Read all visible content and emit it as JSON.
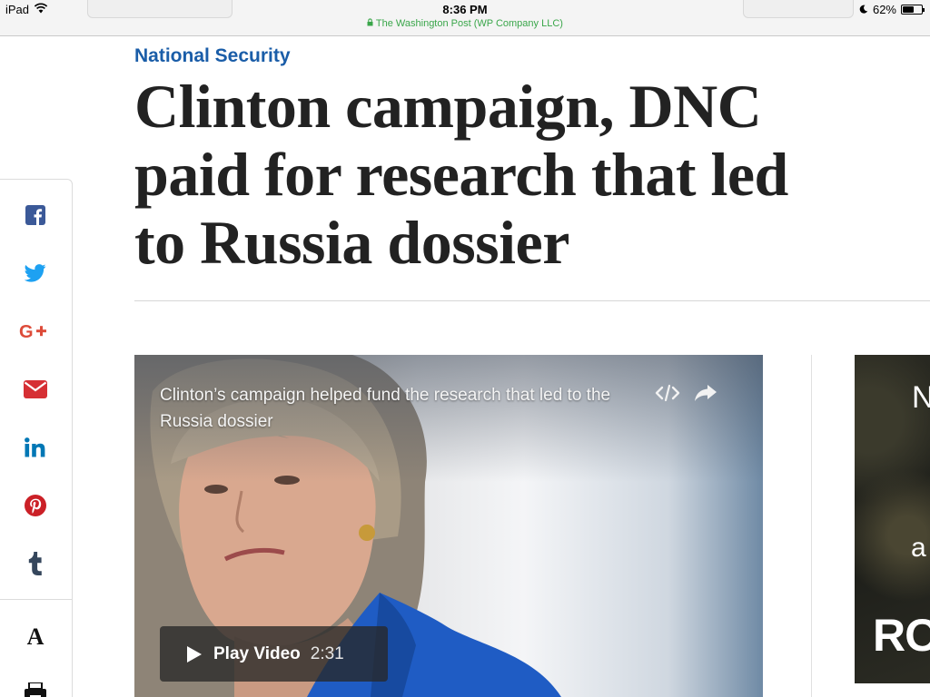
{
  "status_bar": {
    "device": "iPad",
    "time": "8:36 PM",
    "site": "The Washington Post (WP Company LLC)",
    "battery": "62%",
    "battery_level": 0.62
  },
  "article": {
    "section": "National Security",
    "headline": "Clinton campaign, DNC paid for research that led to Russia dossier"
  },
  "share_rail": {
    "items": [
      {
        "name": "facebook-icon",
        "color": "#3b5998"
      },
      {
        "name": "twitter-icon",
        "color": "#1da1f2"
      },
      {
        "name": "google-plus-icon",
        "color": "#dd4b39"
      },
      {
        "name": "email-icon",
        "color": "#d62f34"
      },
      {
        "name": "linkedin-icon",
        "color": "#0077b5"
      },
      {
        "name": "pinterest-icon",
        "color": "#cb2027"
      },
      {
        "name": "tumblr-icon",
        "color": "#35465c"
      }
    ],
    "tools": [
      {
        "name": "text-size-icon",
        "glyph": "A"
      },
      {
        "name": "print-icon"
      }
    ]
  },
  "video": {
    "caption": "Clinton’s campaign helped fund the research that led to the Russia dossier",
    "play_label": "Play Video",
    "duration": "2:31"
  },
  "ad": {
    "line1": "N",
    "line2": "a",
    "line3": "RO"
  }
}
